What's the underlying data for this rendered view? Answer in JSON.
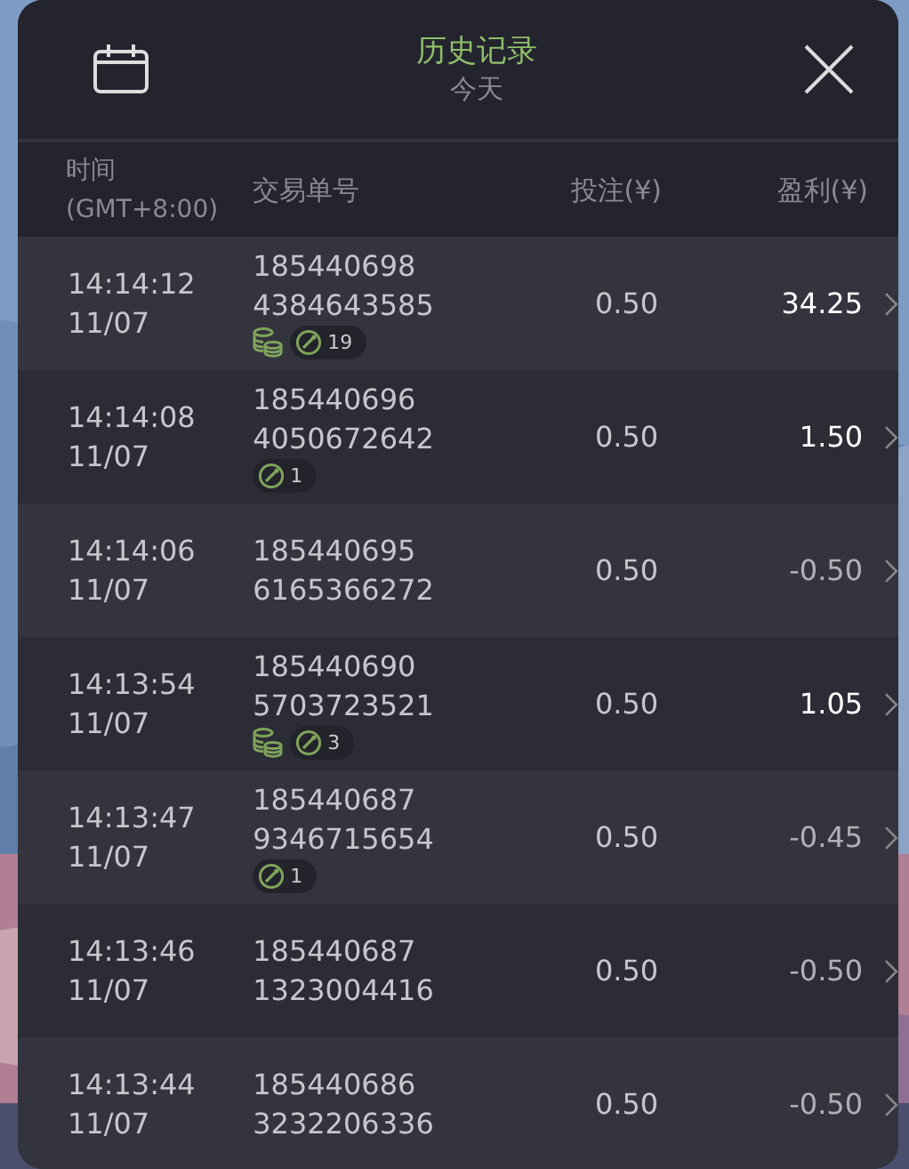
{
  "header": {
    "title": "历史记录",
    "subtitle": "今天"
  },
  "columns": [
    "时间\n(GMT+8:00)",
    "交易单号",
    "投注(¥)",
    "盈利(¥)"
  ],
  "rows": [
    {
      "time": "14:14:12",
      "date": "11/07",
      "order_1": "185440698",
      "order_2": "4384643585",
      "coins": true,
      "badge_count": "19",
      "stake": "0.50",
      "profit": "34.25",
      "win": true
    },
    {
      "time": "14:14:08",
      "date": "11/07",
      "order_1": "185440696",
      "order_2": "4050672642",
      "coins": false,
      "badge_count": "1",
      "stake": "0.50",
      "profit": "1.50",
      "win": true
    },
    {
      "time": "14:14:06",
      "date": "11/07",
      "order_1": "185440695",
      "order_2": "6165366272",
      "coins": false,
      "stake": "0.50",
      "profit": "-0.50",
      "win": false
    },
    {
      "time": "14:13:54",
      "date": "11/07",
      "order_1": "185440690",
      "order_2": "5703723521",
      "coins": true,
      "badge_count": "3",
      "stake": "0.50",
      "profit": "1.05",
      "win": true
    },
    {
      "time": "14:13:47",
      "date": "11/07",
      "order_1": "185440687",
      "order_2": "9346715654",
      "coins": false,
      "badge_count": "1",
      "stake": "0.50",
      "profit": "-0.45",
      "win": false
    },
    {
      "time": "14:13:46",
      "date": "11/07",
      "order_1": "185440687",
      "order_2": "1323004416",
      "coins": false,
      "stake": "0.50",
      "profit": "-0.50",
      "win": false
    },
    {
      "time": "14:13:44",
      "date": "11/07",
      "order_1": "185440686",
      "order_2": "3232206336",
      "coins": false,
      "stake": "0.50",
      "profit": "-0.50",
      "win": false
    }
  ]
}
